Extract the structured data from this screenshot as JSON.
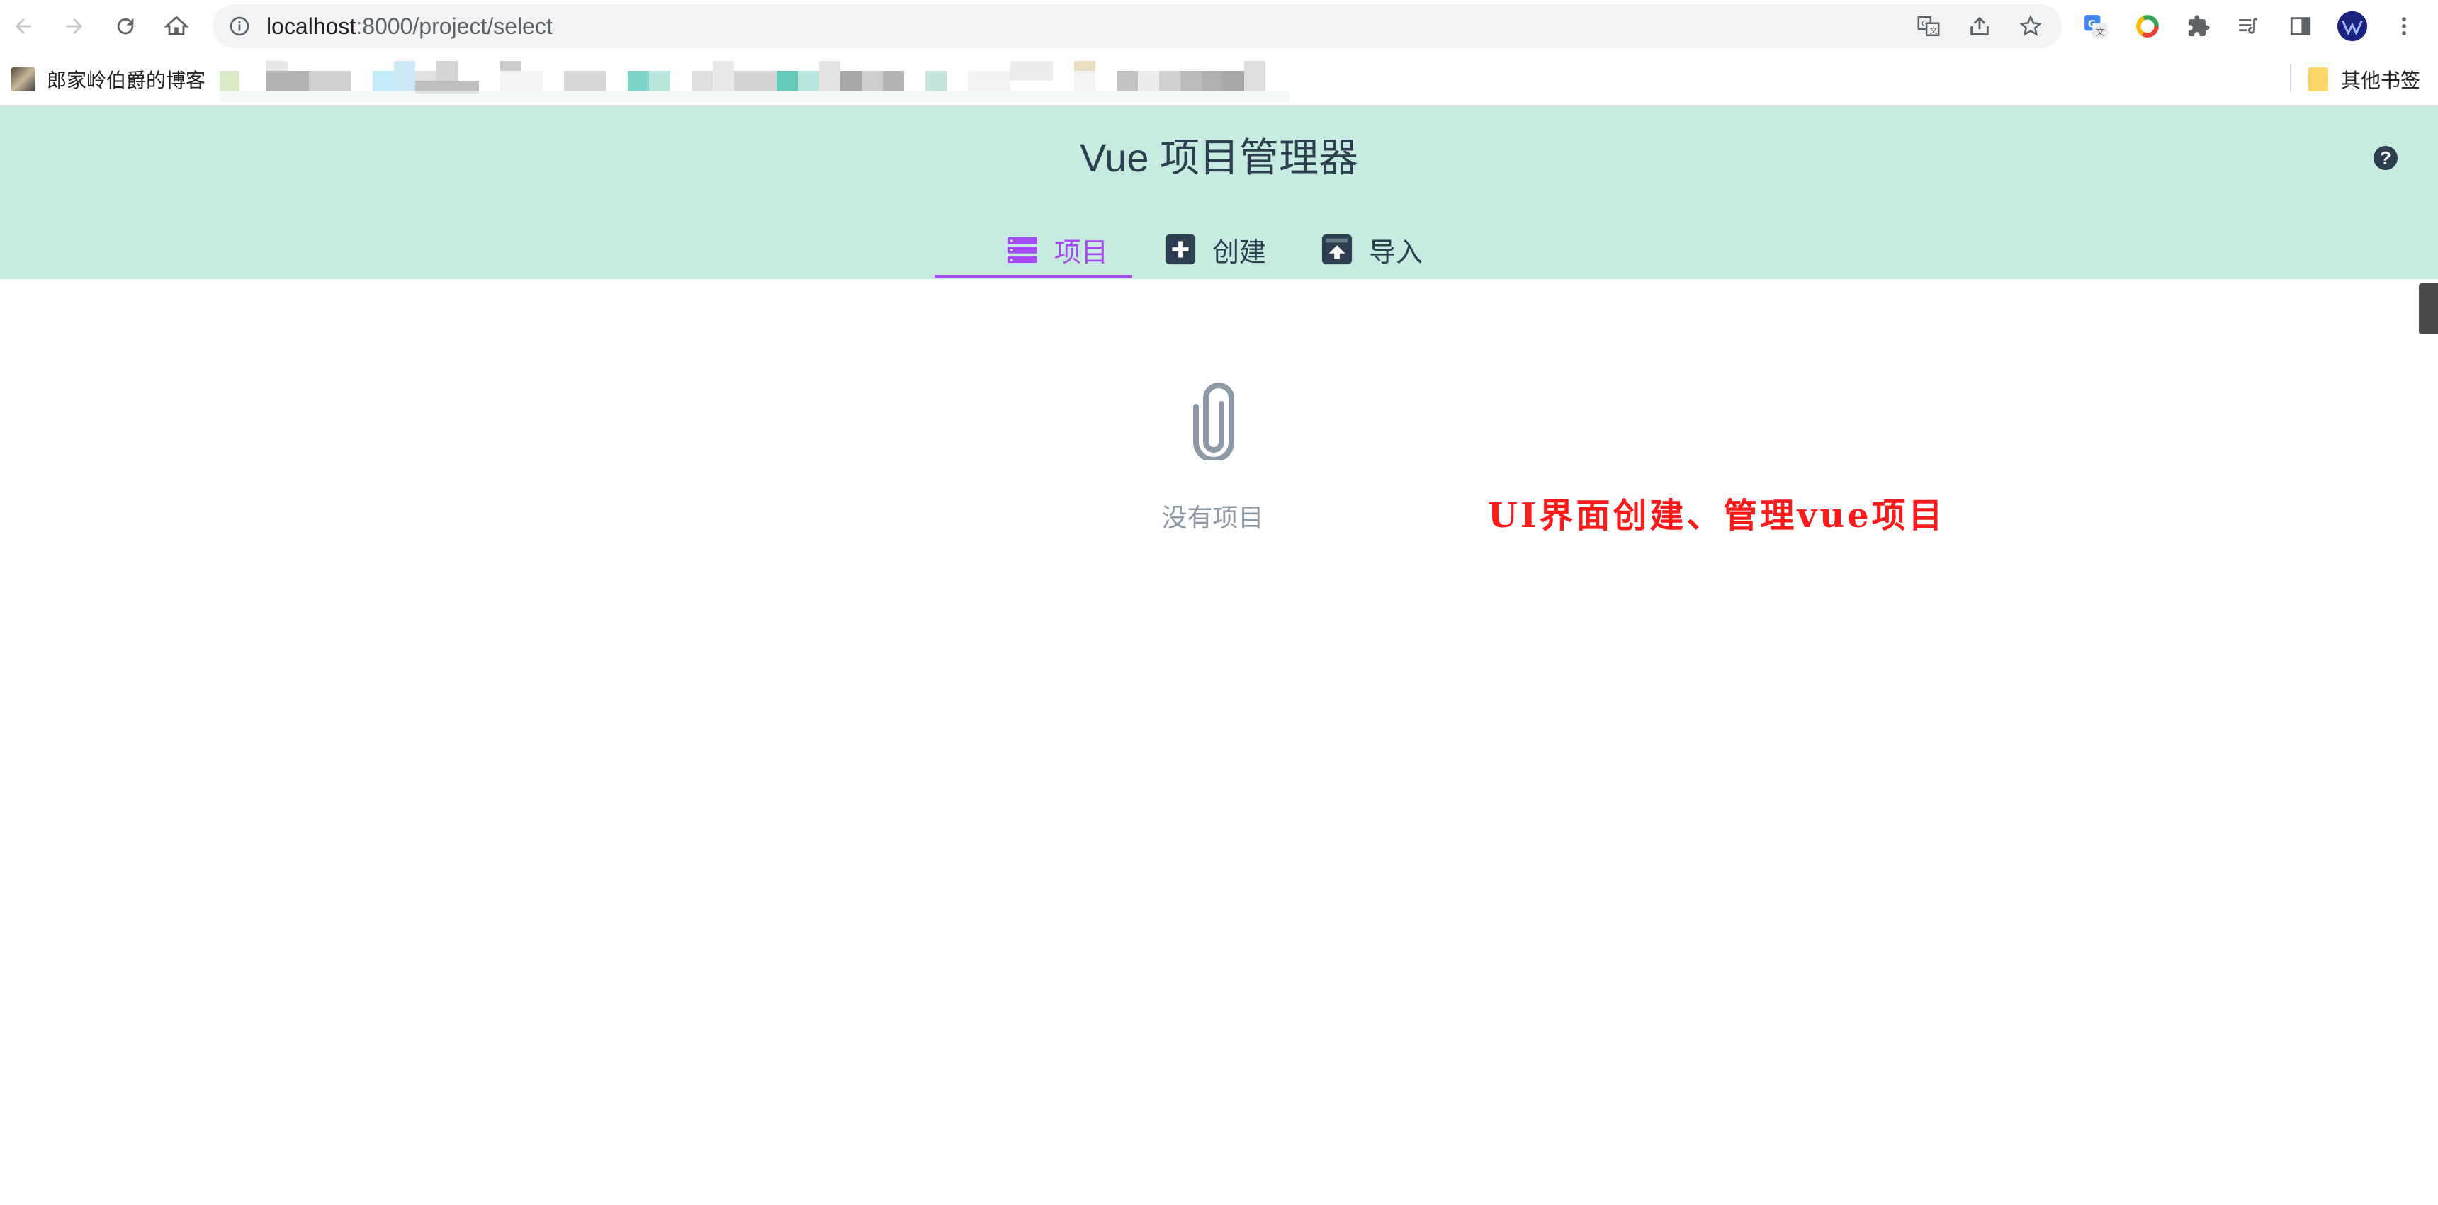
{
  "browser": {
    "url_host": "localhost",
    "url_path": ":8000/project/select",
    "nav_icons": [
      "back-arrow-icon",
      "forward-arrow-icon",
      "reload-icon",
      "home-icon"
    ],
    "omnibox_actions": [
      "translate-icon",
      "share-icon",
      "bookmark-star-icon"
    ],
    "extension_icons": [
      "google-translate-extension-icon",
      "color-ring-extension-icon",
      "puzzle-extensions-icon",
      "reading-list-icon",
      "side-panel-icon",
      "profile-avatar",
      "more-menu-icon"
    ]
  },
  "bookmarks": {
    "first_item": "郎家岭伯爵的博客",
    "other_bookmarks": "其他书签"
  },
  "app": {
    "title": "Vue 项目管理器",
    "help_label": "?",
    "tabs": [
      {
        "label": "项目",
        "icon": "list-icon",
        "active": true
      },
      {
        "label": "创建",
        "icon": "plus-square-icon",
        "active": false
      },
      {
        "label": "导入",
        "icon": "import-upload-icon",
        "active": false
      }
    ],
    "accent_color": "#a44cf1",
    "header_color": "#c7ebe0"
  },
  "main": {
    "empty_icon": "paperclip-icon",
    "empty_text": "没有项目",
    "annotation": "UI界面创建、管理vue项目"
  }
}
